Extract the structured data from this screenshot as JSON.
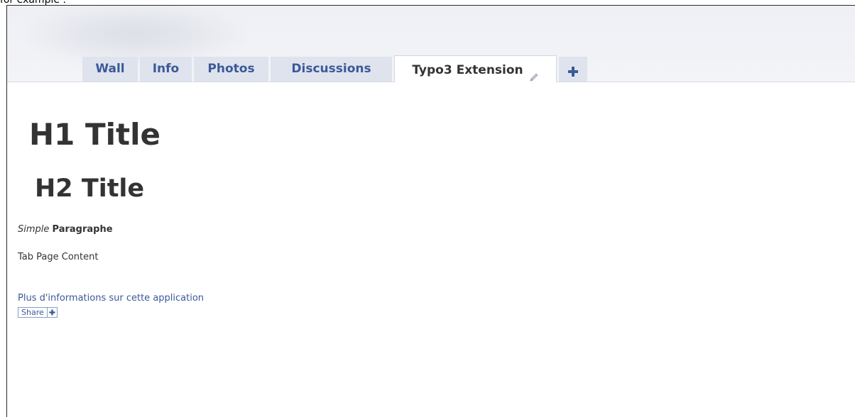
{
  "caption": "for example :",
  "tabs": [
    {
      "label": "Wall",
      "active": false
    },
    {
      "label": "Info",
      "active": false
    },
    {
      "label": "Photos",
      "active": false
    },
    {
      "label": "Discussions",
      "active": false
    },
    {
      "label": "Typo3 Extension",
      "active": true,
      "icon": "pencil-icon"
    },
    {
      "label": "",
      "active": false,
      "icon": "plus-icon"
    }
  ],
  "content": {
    "h1": "H1 Title",
    "h2": "H2 Title",
    "paragraph_italic": "Simple",
    "paragraph_bold": "Paragraphe",
    "tab_page_content": "Tab Page Content",
    "info_link": "Plus d'informations sur cette application",
    "share_label": "Share"
  },
  "colors": {
    "link": "#3b5998",
    "text": "#333333",
    "tab_bg": "#dfe3ee"
  }
}
